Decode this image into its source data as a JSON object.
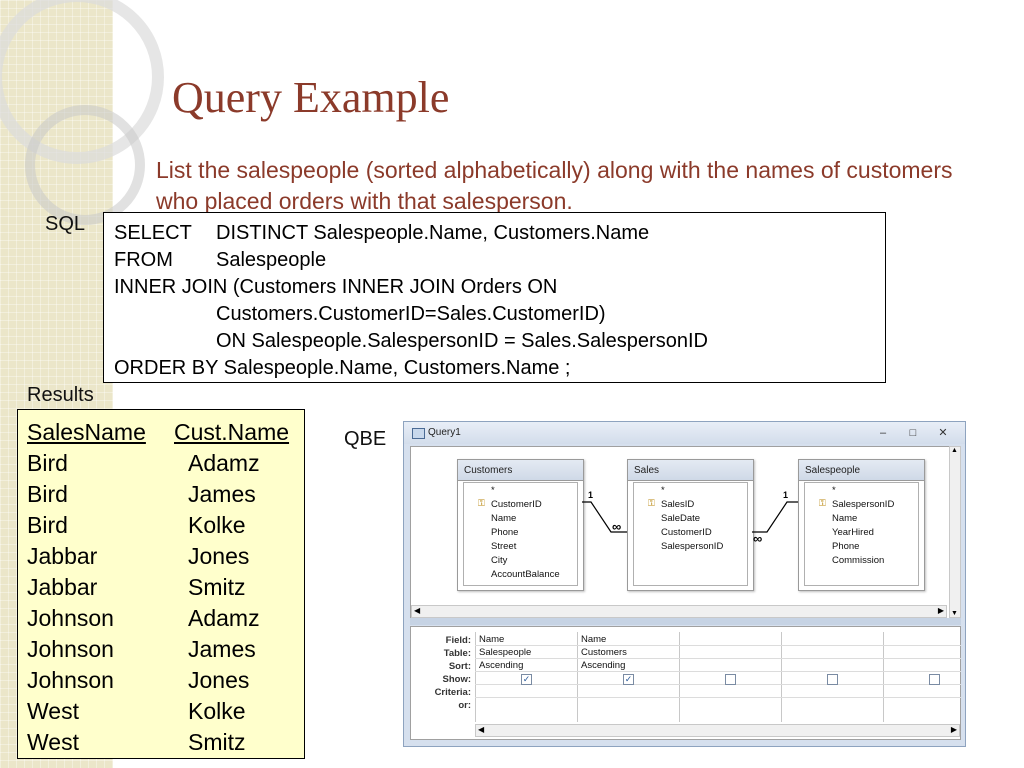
{
  "title": "Query Example",
  "intro": "List the salespeople (sorted alphabetically) along with the names of customers who placed orders with that salesperson.",
  "labels": {
    "sql": "SQL",
    "results": "Results",
    "qbe": "QBE"
  },
  "sql": {
    "l1a": "SELECT",
    "l1b": "DISTINCT Salespeople.Name, Customers.Name",
    "l2a": "FROM",
    "l2b": "Salespeople",
    "l3": "INNER JOIN (Customers INNER JOIN Orders ON",
    "l4": "Customers.CustomerID=Sales.CustomerID)",
    "l5": "ON Salespeople.SalespersonID = Sales.SalespersonID",
    "l6": "ORDER BY Salespeople.Name, Customers.Name ;"
  },
  "results": {
    "headers": [
      "SalesName",
      "Cust.Name"
    ],
    "rows": [
      [
        "Bird",
        "Adamz"
      ],
      [
        "Bird",
        "James"
      ],
      [
        "Bird",
        "Kolke"
      ],
      [
        "Jabbar",
        "Jones"
      ],
      [
        "Jabbar",
        "Smitz"
      ],
      [
        "Johnson",
        "Adamz"
      ],
      [
        "Johnson",
        "James"
      ],
      [
        "Johnson",
        "Jones"
      ],
      [
        "West",
        "Kolke"
      ],
      [
        "West",
        "Smitz"
      ]
    ]
  },
  "qbe": {
    "window_title": "Query1",
    "tables": [
      {
        "name": "Customers",
        "fields": [
          "*",
          "CustomerID",
          "Name",
          "Phone",
          "Street",
          "City",
          "AccountBalance"
        ]
      },
      {
        "name": "Sales",
        "fields": [
          "*",
          "SalesID",
          "SaleDate",
          "CustomerID",
          "SalespersonID"
        ]
      },
      {
        "name": "Salespeople",
        "fields": [
          "*",
          "SalespersonID",
          "Name",
          "YearHired",
          "Phone",
          "Commission"
        ]
      }
    ],
    "rel_one": "1",
    "rel_many": "∞",
    "grid_labels": [
      "Field:",
      "Table:",
      "Sort:",
      "Show:",
      "Criteria:",
      "or:"
    ],
    "columns": [
      {
        "field": "Name",
        "table": "Salespeople",
        "sort": "Ascending",
        "show": true
      },
      {
        "field": "Name",
        "table": "Customers",
        "sort": "Ascending",
        "show": true
      },
      {
        "field": "",
        "table": "",
        "sort": "",
        "show": false
      },
      {
        "field": "",
        "table": "",
        "sort": "",
        "show": false
      },
      {
        "field": "",
        "table": "",
        "sort": "",
        "show": false
      }
    ]
  }
}
